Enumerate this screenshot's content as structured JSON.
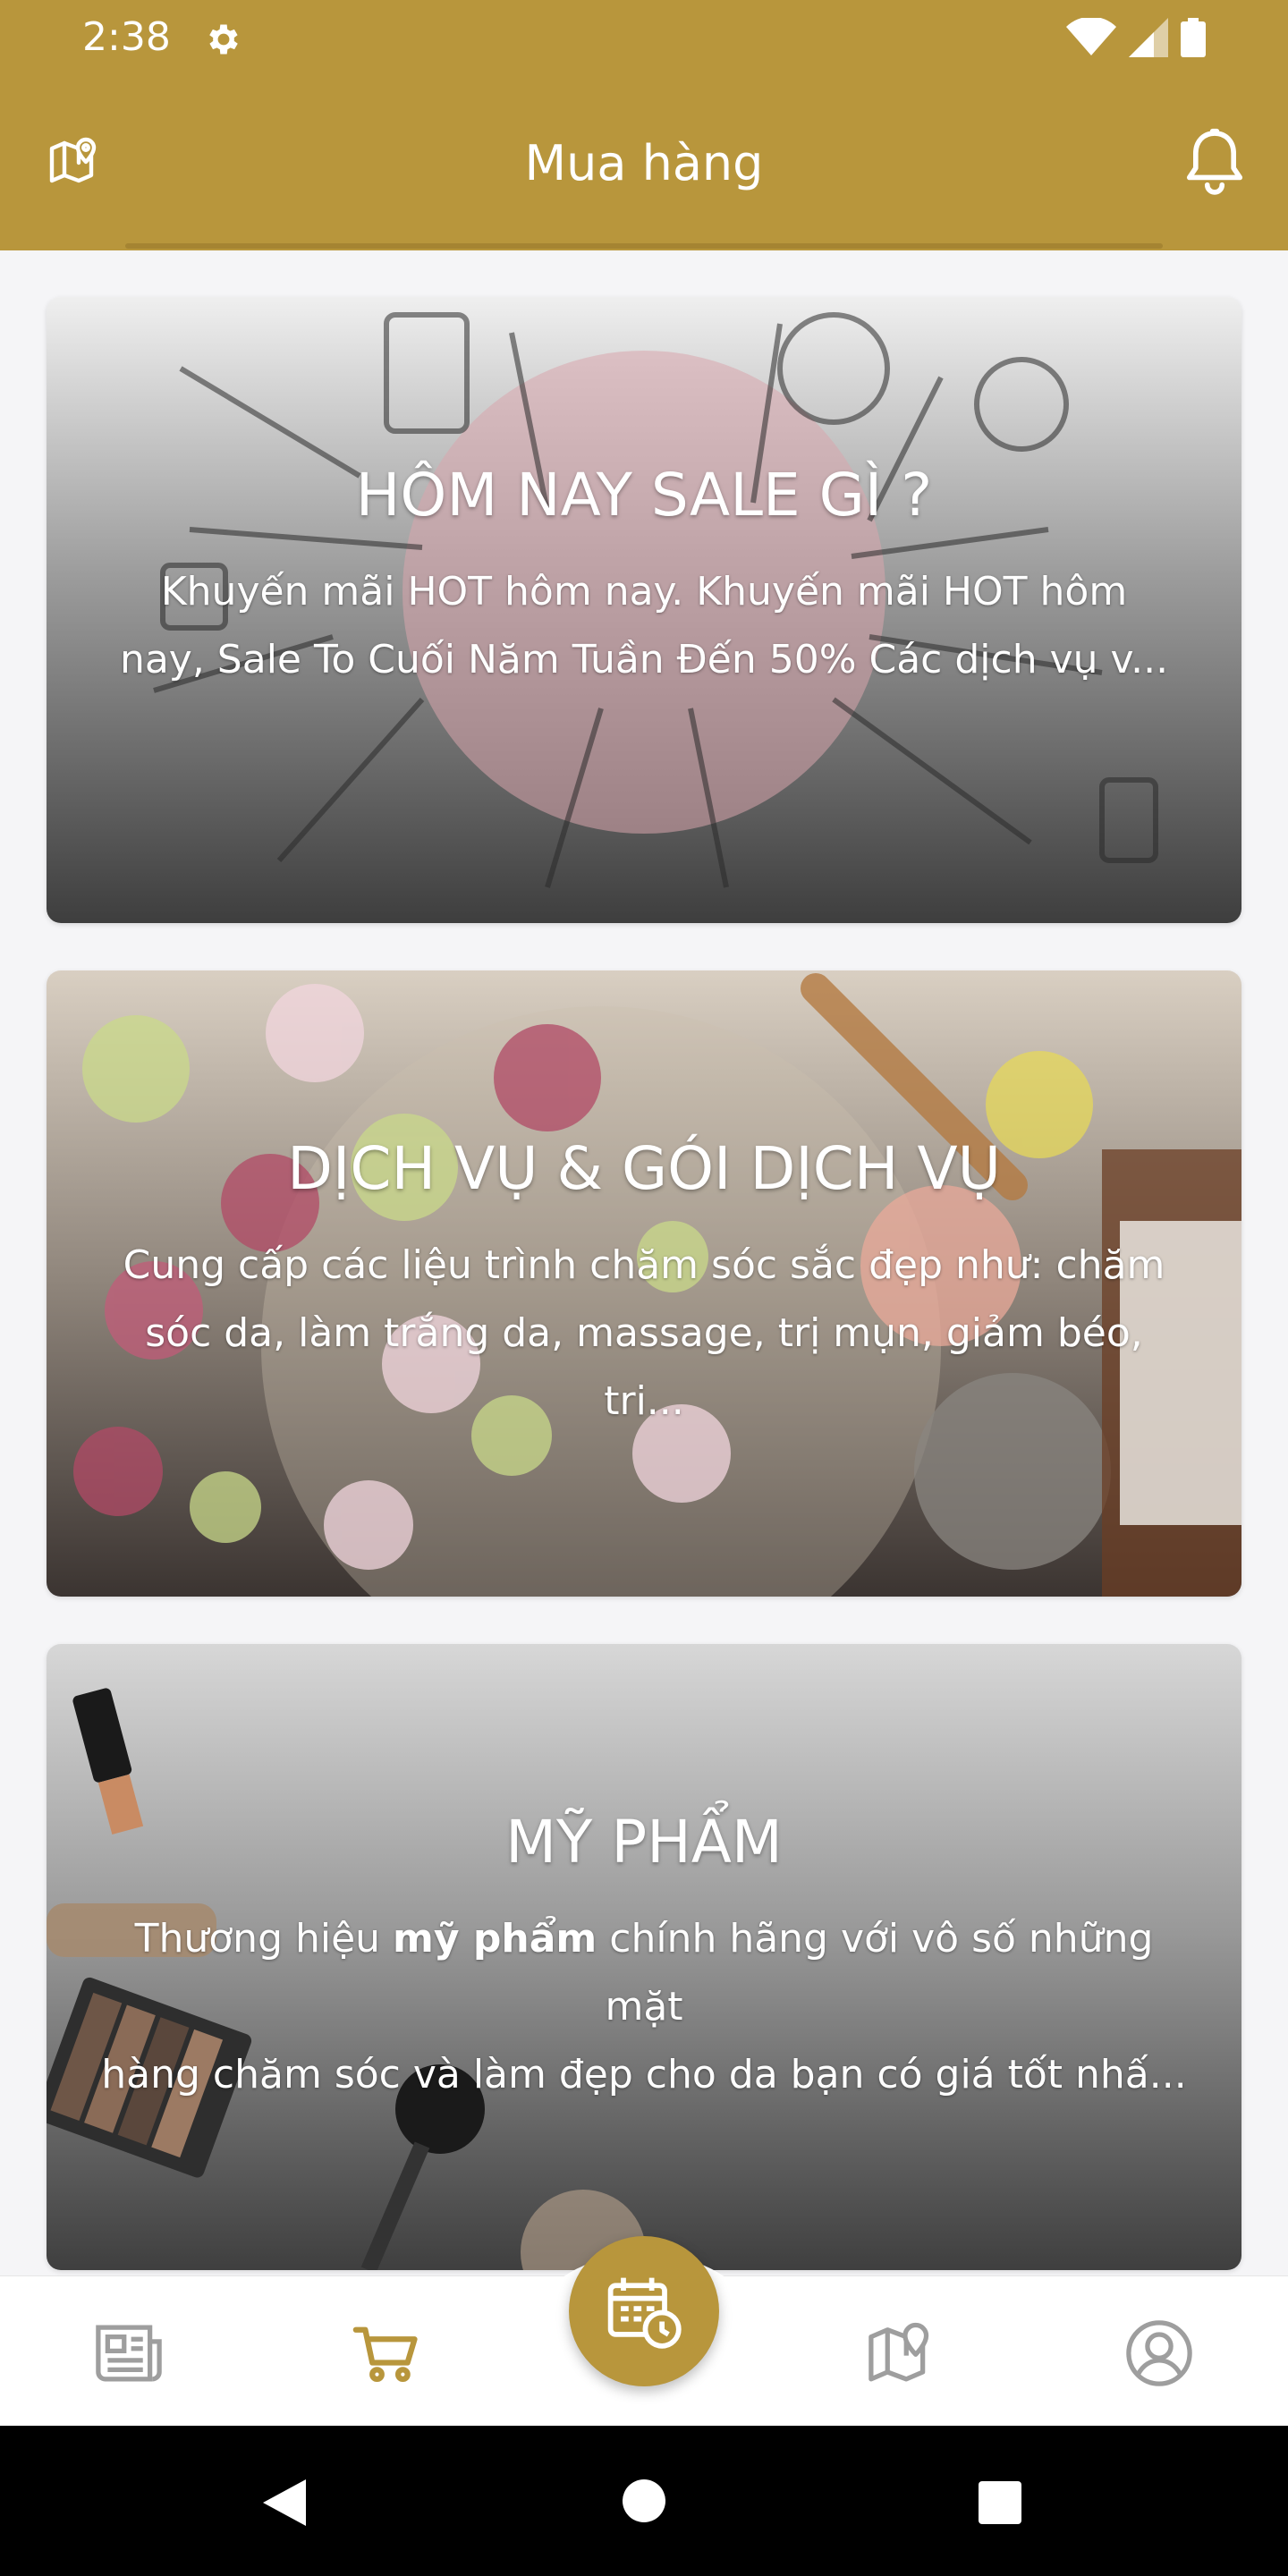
{
  "status_bar": {
    "time": "2:38"
  },
  "app_bar": {
    "title": "Mua hàng"
  },
  "cards": [
    {
      "title": "HÔM NAY SALE GÌ ?",
      "desc_line1": "Khuyến mãi HOT hôm nay. Khuyến mãi HOT hôm",
      "desc_line2": "nay, Sale To Cuối Năm Tuần Đến 50% Các dịch vụ v..."
    },
    {
      "title": "DỊCH VỤ & GÓI DỊCH VỤ",
      "desc_line1": "Cung cấp các liệu trình chăm sóc sắc đẹp như: chăm",
      "desc_line2": "sóc da, làm trắng da, massage, trị mụn, giảm béo, tri..."
    },
    {
      "title": "MỸ PHẨM",
      "desc_line1_prefix": "Thương hiệu ",
      "desc_line1_bold": "mỹ phẩm",
      "desc_line1_suffix": " chính hãng với vô số những mặt",
      "desc_line2": "hàng chăm sóc và làm đẹp cho da bạn có giá tốt nhấ..."
    }
  ],
  "bottom_nav": {
    "items": [
      {
        "icon": "news-icon"
      },
      {
        "icon": "cart-icon",
        "active": true
      },
      {
        "icon": "calendar-clock-icon"
      },
      {
        "icon": "map-icon"
      },
      {
        "icon": "profile-icon"
      }
    ]
  },
  "colors": {
    "brand": "#b8963c",
    "inactive_icon": "#9e9e9e"
  }
}
